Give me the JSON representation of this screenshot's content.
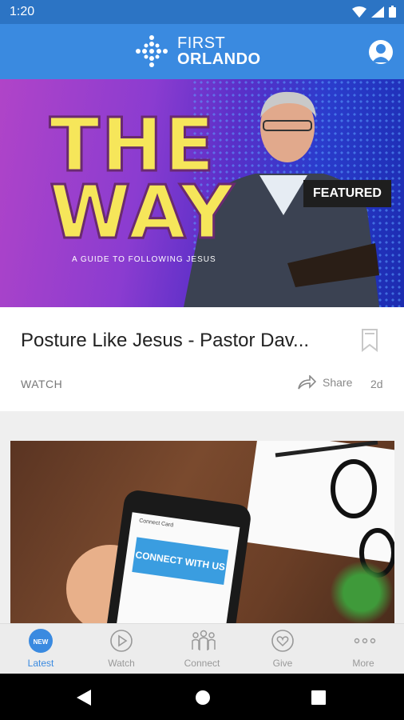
{
  "status": {
    "time": "1:20"
  },
  "app": {
    "logo_line1": "FIRST",
    "logo_line2": "ORLANDO"
  },
  "hero": {
    "badge": "FEATURED",
    "title": "THE WAY",
    "subtitle": "A GUIDE TO FOLLOWING JESUS"
  },
  "featured_card": {
    "title": "Posture Like Jesus - Pastor Dav...",
    "category": "WATCH",
    "share_label": "Share",
    "age": "2d"
  },
  "second_card": {
    "image_text": "CONNECT WITH US",
    "screen_header": "Connect Card"
  },
  "nav": {
    "items": [
      {
        "label": "Latest",
        "icon": "new-badge-icon"
      },
      {
        "label": "Watch",
        "icon": "play-icon"
      },
      {
        "label": "Connect",
        "icon": "people-icon"
      },
      {
        "label": "Give",
        "icon": "heart-icon"
      },
      {
        "label": "More",
        "icon": "more-dots-icon"
      }
    ],
    "new_badge": "NEW"
  },
  "colors": {
    "status_bar": "#2c74c4",
    "app_bar": "#3a8ae0",
    "active_tab": "#3a8ae0"
  }
}
